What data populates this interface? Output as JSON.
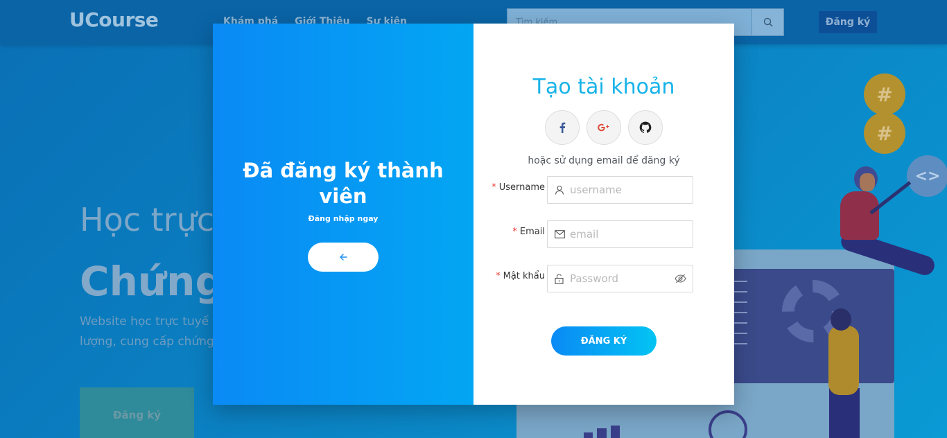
{
  "site": {
    "logo": "UCourse",
    "nav": [
      "Khám phá",
      "Giới Thiệu",
      "Sự kiện"
    ],
    "search_placeholder": "Tìm kiếm",
    "register_label": "Đăng ký"
  },
  "hero": {
    "line1": "Học trực",
    "line2": "Chứng",
    "desc_line1": "Website học trực tuyế",
    "desc_line2": "lượng, cung cấp chứng",
    "cta_label": "Đăng ký"
  },
  "decor": {
    "hash_symbol": "#",
    "code_symbol": "<>"
  },
  "modal": {
    "left": {
      "title": "Đã đăng ký thành viên",
      "subtitle": "Đăng nhập ngay",
      "back_icon": "arrow-left-icon"
    },
    "right": {
      "title": "Tạo tài khoản",
      "social": [
        "facebook-icon",
        "google-plus-icon",
        "github-icon"
      ],
      "alt_text": "hoặc sử dụng email để đăng ký",
      "fields": {
        "username": {
          "label": "Username",
          "placeholder": "username",
          "required_mark": "*"
        },
        "email": {
          "label": "Email",
          "placeholder": "email",
          "required_mark": "*"
        },
        "password": {
          "label": "Mật khẩu",
          "placeholder": "Password",
          "required_mark": "*"
        }
      },
      "submit_label": "ĐĂNG KÝ"
    }
  },
  "colors": {
    "accent": "#17b3e8",
    "gradient_start": "#0a8af5",
    "gradient_end": "#03a6f3",
    "required": "#e53935"
  }
}
